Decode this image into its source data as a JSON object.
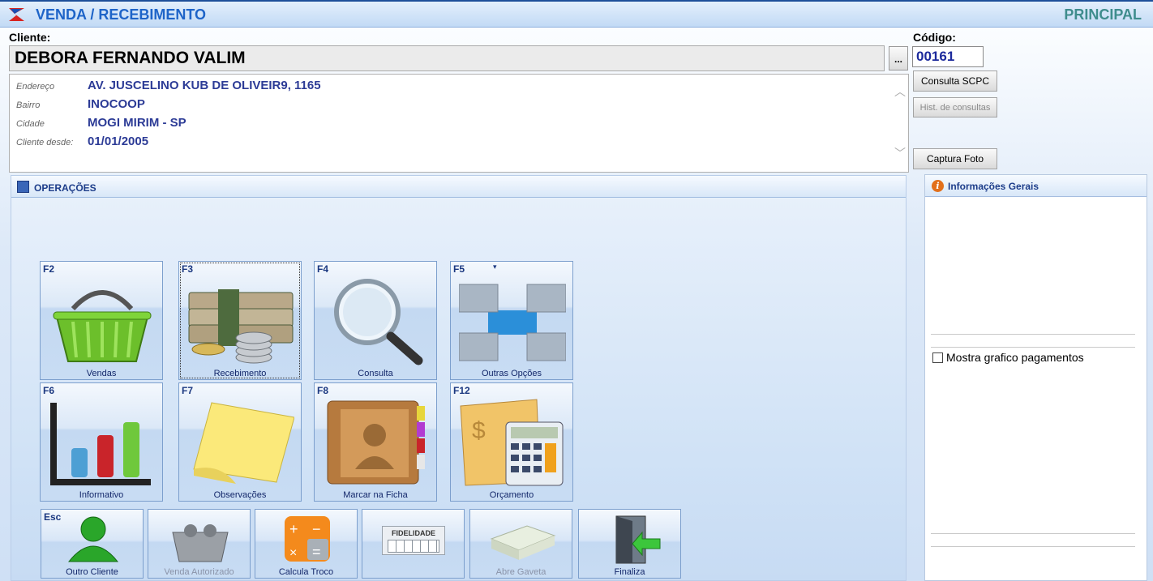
{
  "header": {
    "title": "VENDA / RECEBIMENTO",
    "right_label": "PRINCIPAL"
  },
  "cliente": {
    "label": "Cliente:",
    "name": "DEBORA FERNANDO VALIM",
    "lookup_button": "..."
  },
  "codigo": {
    "label": "Código:",
    "value": "00161"
  },
  "buttons": {
    "consulta_scpc": "Consulta SCPC",
    "hist_consultas": "Hist. de consultas",
    "captura_foto": "Captura Foto"
  },
  "client_info": [
    {
      "key": "Endereço",
      "value": "AV. JUSCELINO KUB DE OLIVEIR9, 1165"
    },
    {
      "key": "Bairro",
      "value": "INOCOOP"
    },
    {
      "key": "Cidade",
      "value": "MOGI MIRIM - SP"
    },
    {
      "key": "Cliente desde:",
      "value": "01/01/2005"
    }
  ],
  "operations": {
    "title": "OPERAÇÕES",
    "tiles": [
      {
        "key": "F2",
        "label": "Vendas"
      },
      {
        "key": "F3",
        "label": "Recebimento"
      },
      {
        "key": "F4",
        "label": "Consulta"
      },
      {
        "key": "F5",
        "label": "Outras Opções"
      },
      {
        "key": "F6",
        "label": "Informativo"
      },
      {
        "key": "F7",
        "label": "Observações"
      },
      {
        "key": "F8",
        "label": "Marcar na Ficha"
      },
      {
        "key": "F12",
        "label": "Orçamento"
      }
    ],
    "bottom": [
      {
        "key": "Esc",
        "label": "Outro Cliente"
      },
      {
        "key": "",
        "label": "Venda Autorizado"
      },
      {
        "key": "",
        "label": "Calcula Troco"
      },
      {
        "key": "",
        "label": "",
        "badge": "FIDELIDADE"
      },
      {
        "key": "",
        "label": "Abre Gaveta"
      },
      {
        "key": "",
        "label": "Finaliza"
      }
    ]
  },
  "info_panel": {
    "title": "Informações Gerais",
    "checkbox_label": "Mostra grafico pagamentos",
    "checkbox_checked": false
  }
}
